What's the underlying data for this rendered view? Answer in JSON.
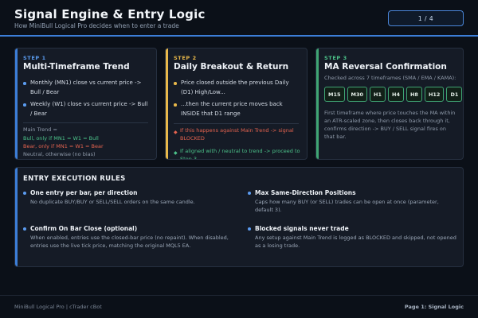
{
  "header": {
    "title": "Signal Engine & Entry Logic",
    "subtitle": "How MiniBull Logical Pro decides when to enter a trade",
    "page_indicator": "1 / 4"
  },
  "colors": {
    "accent_blue": "#3c7ed8",
    "step1": "#3c7ed8",
    "step2": "#e8b84a",
    "step3": "#3fa573",
    "bull": "#4cc38a",
    "bear": "#e5634f"
  },
  "steps": [
    {
      "tag": "STEP 1",
      "title": "Multi-Timeframe Trend",
      "bullets": [
        "Monthly (MN1) close vs current price -> Bull / Bear",
        "Weekly (W1) close vs current price -> Bull / Bear"
      ],
      "main_trend_label": "Main Trend =",
      "bull_rule": "Bull, only if MN1 = W1 = Bull",
      "bear_rule": "Bear, only if MN1 = W1 = Bear",
      "neutral_rule": "Neutral, otherwise (no bias)"
    },
    {
      "tag": "STEP 2",
      "title": "Daily Breakout & Return",
      "bullets": [
        "Price closed outside the previous Daily (D1) High/Low...",
        "...then the current price moves back INSIDE that D1 range"
      ],
      "blocked_rule": "If this happens against Main Trend -> signal BLOCKED",
      "proceed_rule": "If aligned with / neutral to trend -> proceed to Step 3"
    },
    {
      "tag": "STEP 3",
      "title": "MA Reversal Confirmation",
      "checked_text": "Checked across 7 timeframes (SMA / EMA / KAMA):",
      "timeframes": [
        "M15",
        "M30",
        "H1",
        "H4",
        "H8",
        "H12",
        "D1"
      ],
      "description": "First timeframe where price touches the MA within an ATR-scaled zone, then closes back through it, confirms direction -> BUY / SELL signal fires on that bar."
    }
  ],
  "rules": {
    "title": "ENTRY EXECUTION RULES",
    "items": [
      {
        "title": "One entry per bar, per direction",
        "desc": "No duplicate BUY/BUY or SELL/SELL orders on the same candle."
      },
      {
        "title": "Max Same-Direction Positions",
        "desc": "Caps how many BUY (or SELL) trades can be open at once (parameter, default 3)."
      },
      {
        "title": "Confirm On Bar Close (optional)",
        "desc": "When enabled, entries use the closed-bar price (no repaint). When disabled, entries use the live tick price, matching the original MQL5 EA."
      },
      {
        "title": "Blocked signals never trade",
        "desc": "Any setup against Main Trend is logged as BLOCKED and skipped, not opened as a losing trade."
      }
    ]
  },
  "footer": {
    "left": "MiniBull Logical Pro  |  cTrader cBot",
    "right": "Page 1: Signal Logic"
  }
}
